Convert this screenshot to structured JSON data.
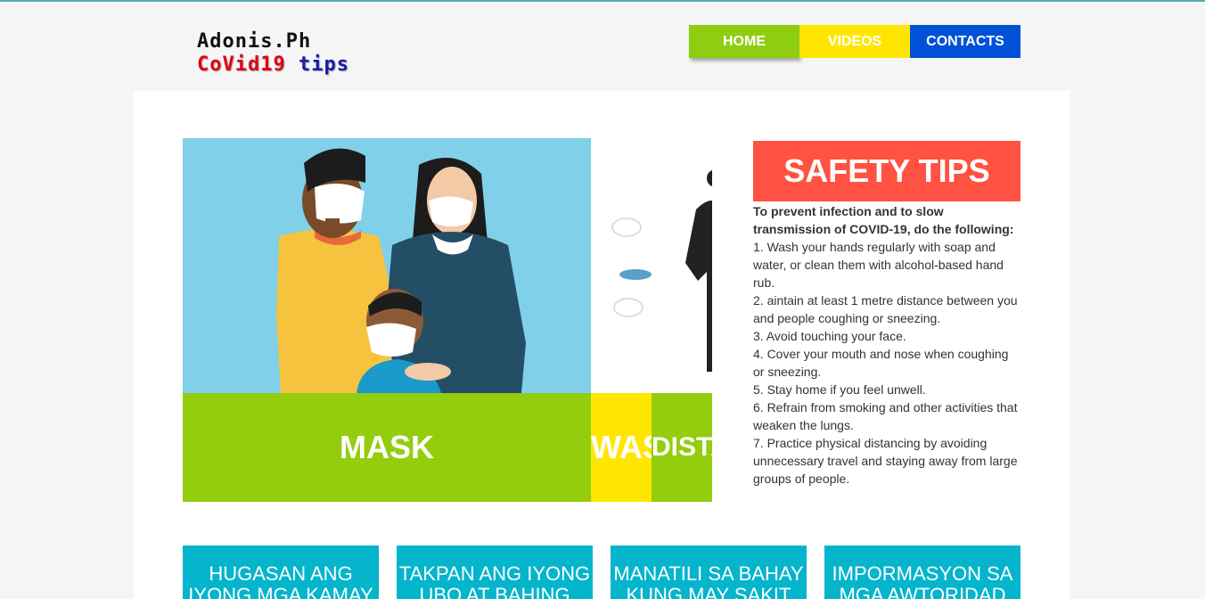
{
  "logo": {
    "line1": "Adonis.Ph",
    "line2a": "CoVid19",
    "line2b": "tips"
  },
  "nav": [
    {
      "label": "HOME"
    },
    {
      "label": "VIDEOS"
    },
    {
      "label": "CONTACTS"
    }
  ],
  "slides": [
    {
      "caption": "MASK"
    },
    {
      "caption": "WASH"
    },
    {
      "caption": "DISTANCE"
    }
  ],
  "tips": {
    "title": "SAFETY TIPS",
    "intro": "To prevent infection and to slow transmission of COVID-19, do the following:",
    "items": [
      "1. Wash your hands regularly with soap and water, or clean them with alcohol-based hand rub.",
      "2. aintain at least 1 metre distance between you and people coughing or sneezing.",
      "3. Avoid touching your face.",
      "4. Cover your mouth and nose when coughing or sneezing.",
      "5. Stay home if you feel unwell.",
      "6. Refrain from smoking and other activities that weaken the lungs.",
      "7. Practice physical distancing by avoiding unnecessary travel and staying away from large groups of people."
    ]
  },
  "cards": [
    {
      "label": "HUGASAN ANG IYONG MGA KAMAY"
    },
    {
      "label": "TAKPAN ANG IYONG UBO AT BAHING"
    },
    {
      "label": "MANATILI SA BAHAY KUNG MAY SAKIT"
    },
    {
      "label": "IMPORMASYON SA MGA AWTORIDAD"
    }
  ],
  "colors": {
    "home": "#8fcd12",
    "videos": "#ffe600",
    "contacts": "#0051d6",
    "tips_header": "#ff5242",
    "card": "#04b5cc"
  }
}
